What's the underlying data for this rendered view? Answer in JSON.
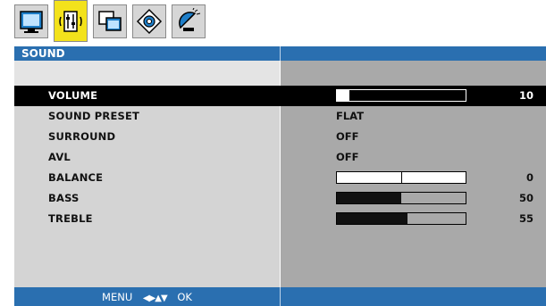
{
  "tabs": [
    {
      "name": "picture",
      "icon": "monitor-icon",
      "active": false
    },
    {
      "name": "sound",
      "icon": "equalizer-icon",
      "active": true
    },
    {
      "name": "features",
      "icon": "windows-icon",
      "active": false
    },
    {
      "name": "install",
      "icon": "gear-icon",
      "active": false
    },
    {
      "name": "satellite",
      "icon": "satellite-dish-icon",
      "active": false
    }
  ],
  "menu": {
    "title": "SOUND"
  },
  "settings": [
    {
      "label": "VOLUME",
      "type": "bar",
      "value": 10,
      "display": "10",
      "selected": true
    },
    {
      "label": "SOUND PRESET",
      "type": "text",
      "display": "FLAT"
    },
    {
      "label": "SURROUND",
      "type": "text",
      "display": "OFF"
    },
    {
      "label": "AVL",
      "type": "text",
      "display": "OFF"
    },
    {
      "label": "BALANCE",
      "type": "balance",
      "value": 0,
      "display": "0"
    },
    {
      "label": "BASS",
      "type": "bar",
      "value": 50,
      "display": "50"
    },
    {
      "label": "TREBLE",
      "type": "bar",
      "value": 55,
      "display": "55"
    }
  ],
  "footer": {
    "menu_label": "MENU",
    "ok_label": "OK",
    "nav_symbols": "◀▶▲▼"
  },
  "colors": {
    "title_band": "#2a6fb0",
    "active_tab": "#f3e21c",
    "left_panel": "#d4d4d4",
    "right_panel": "#a9a9a9",
    "selected_row": "#000000"
  }
}
